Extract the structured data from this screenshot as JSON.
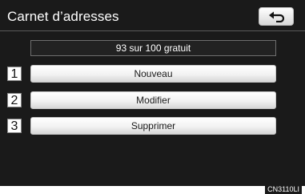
{
  "header": {
    "title": "Carnet d’adresses",
    "back_icon": "back-arrow-icon"
  },
  "status": {
    "text": "93 sur 100 gratuit"
  },
  "menu": {
    "items": [
      {
        "number": "1",
        "label": "Nouveau"
      },
      {
        "number": "2",
        "label": "Modifier"
      },
      {
        "number": "3",
        "label": "Supprimer"
      }
    ]
  },
  "footer": {
    "code": "CN3110LI"
  }
}
